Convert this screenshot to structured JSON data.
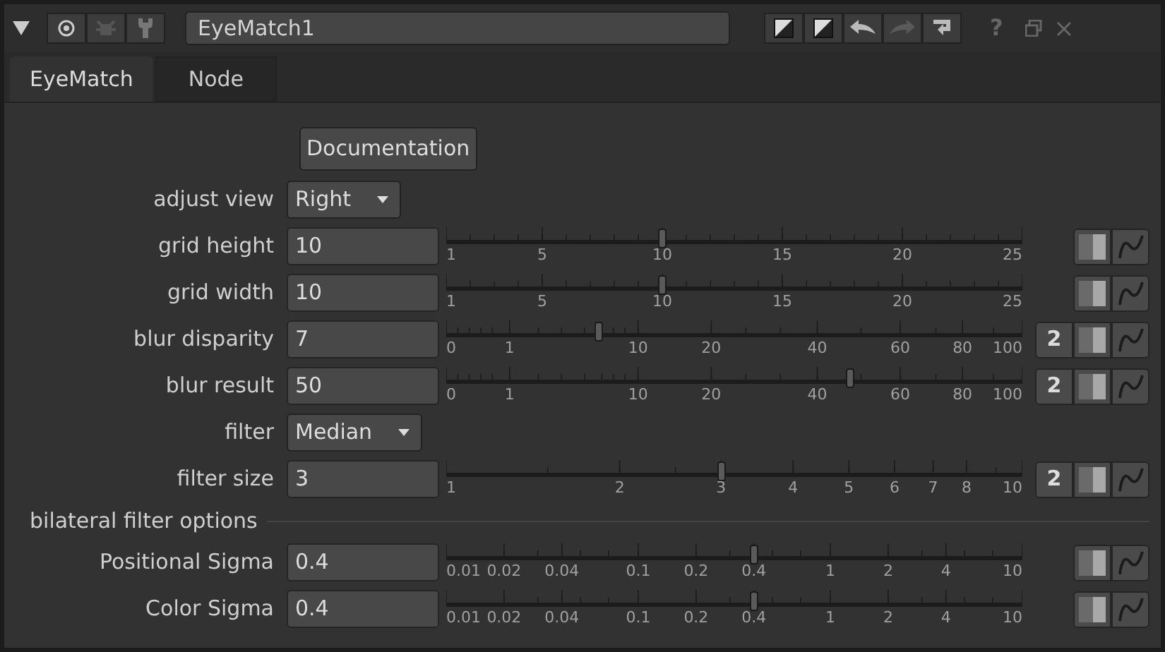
{
  "header": {
    "node_name": "EyeMatch1",
    "help": "?",
    "redo": {
      "disabled": true
    }
  },
  "tabs": [
    {
      "label": "EyeMatch",
      "selected": true
    },
    {
      "label": "Node",
      "selected": false
    }
  ],
  "controls": [
    {
      "kind": "button",
      "text": "Documentation"
    },
    {
      "kind": "dropdown",
      "label": "adjust view",
      "value": "Right"
    },
    {
      "kind": "slider",
      "label": "grid height",
      "value": "10",
      "ticks": [
        "1",
        "5",
        "10",
        "15",
        "20",
        "25"
      ],
      "level": 0.375
    },
    {
      "kind": "slider",
      "label": "grid width",
      "value": "10",
      "ticks": [
        "1",
        "5",
        "10",
        "15",
        "20",
        "25"
      ],
      "level": 0.375
    },
    {
      "kind": "slider",
      "label": "blur disparity",
      "value": "7",
      "ticks": [
        "0",
        "1",
        "10",
        "20",
        "40",
        "60",
        "80",
        "100"
      ],
      "level": 0.264,
      "views": "2"
    },
    {
      "kind": "slider",
      "label": "blur result",
      "value": "50",
      "ticks": [
        "0",
        "1",
        "10",
        "20",
        "40",
        "60",
        "80",
        "100"
      ],
      "level": 0.7,
      "views": "2"
    },
    {
      "kind": "dropdown",
      "label": "filter",
      "value": "Median"
    },
    {
      "kind": "slider",
      "label": "filter size",
      "value": "3",
      "ticks": [
        "1",
        "2",
        "3",
        "4",
        "5",
        "6",
        "7",
        "8",
        "10"
      ],
      "level": 0.477,
      "views": "2"
    },
    {
      "kind": "section",
      "label": "bilateral filter options"
    },
    {
      "kind": "slider",
      "label": "Positional Sigma",
      "value": "0.4",
      "ticks": [
        "0.01",
        "0.02",
        "0.04",
        "0.1",
        "0.2",
        "0.4",
        "1",
        "2",
        "4",
        "10"
      ],
      "level": 0.534
    },
    {
      "kind": "slider",
      "label": "Color Sigma",
      "value": "0.4",
      "ticks": [
        "0.01",
        "0.02",
        "0.04",
        "0.1",
        "0.2",
        "0.4",
        "1",
        "2",
        "4",
        "10"
      ],
      "level": 0.534
    }
  ]
}
